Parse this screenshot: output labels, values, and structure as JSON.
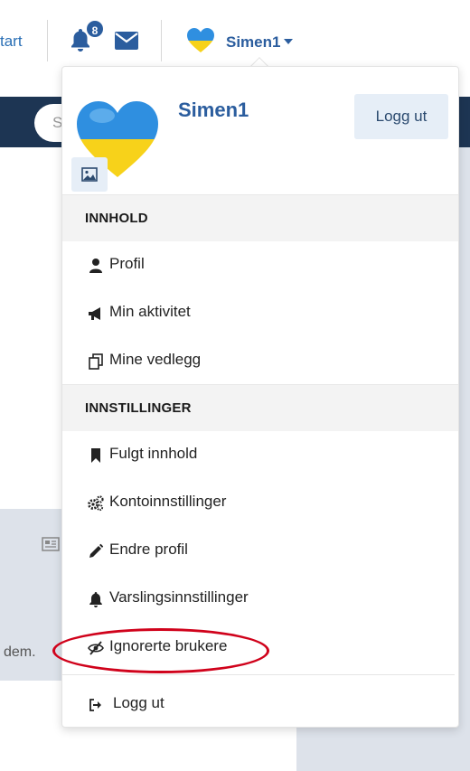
{
  "header": {
    "start_link": "tart",
    "notifications_count": "8",
    "username": "Simen1"
  },
  "background": {
    "search_placeholder": "S",
    "card_text": "dem."
  },
  "dropdown": {
    "username": "Simen1",
    "logout_button": "Logg ut",
    "sections": [
      {
        "title": "INNHOLD"
      },
      {
        "title": "INNSTILLINGER"
      }
    ],
    "items": [
      {
        "label": "Profil",
        "icon": "user-icon"
      },
      {
        "label": "Min aktivitet",
        "icon": "bullhorn-icon"
      },
      {
        "label": "Mine vedlegg",
        "icon": "files-icon"
      },
      {
        "label": "Fulgt innhold",
        "icon": "bookmark-icon"
      },
      {
        "label": "Kontoinnstillinger",
        "icon": "cogs-icon"
      },
      {
        "label": "Endre profil",
        "icon": "pencil-icon"
      },
      {
        "label": "Varslingsinnstillinger",
        "icon": "bell-icon"
      },
      {
        "label": "Ignorerte brukere",
        "icon": "eye-slash-icon"
      },
      {
        "label": "Logg ut",
        "icon": "sign-out-icon"
      }
    ]
  },
  "colors": {
    "brand": "#2b5d9e",
    "nav": "#1d3553",
    "highlight": "#d0021b"
  }
}
